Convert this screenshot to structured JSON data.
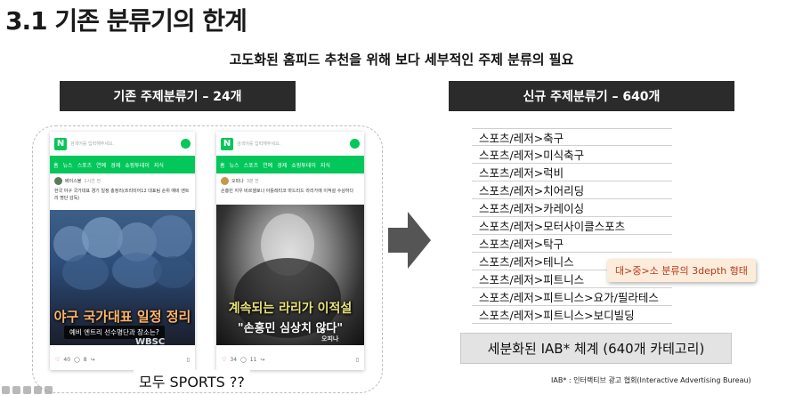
{
  "title": "3.1 기존 분류기의 한계",
  "subtitle": "고도화된 홈피드 추천을 위해 보다 세부적인 주제 분류의 필요",
  "left_header": "기존 주제분류기 – 24개",
  "right_header": "신규 주제분류기 – 640개",
  "phone1": {
    "search_placeholder": "검색어를 입력해주세요.",
    "tabs": [
      "홈",
      "뉴스",
      "스포츠",
      "연예",
      "경제",
      "쇼핑투데이",
      "지식"
    ],
    "author": "베이스볼",
    "time": "1시간 전",
    "text": "한국 야구 국가대표 경기 일정 총정리(프리미어12 대표팀 순위 예비 엔트리 명단 감독)",
    "caption_main": "야구 국가대표 일정 정리",
    "caption_sub": "예비 엔트리 선수명단과 장소는?",
    "watermark": "WBSC",
    "likes": "40",
    "comments": "8"
  },
  "phone2": {
    "search_placeholder": "검색어를 입력해주세요.",
    "tabs": [
      "홈",
      "뉴스",
      "스포츠",
      "연예",
      "경제",
      "쇼핑투데이",
      "지식"
    ],
    "author": "오피나",
    "time": "3분 전",
    "text": "손흥민 지우 비르셀로나 아틀레티코 마드리드 라리가에 이적설 수상하다",
    "caption_main": "계속되는 라리가 이적설",
    "caption_sub": "\"손흥민 심상치 않다\"",
    "watermark": "오피나",
    "likes": "34",
    "comments": "11"
  },
  "bottom_question": "모두 SPORTS ??",
  "taxonomy": [
    "스포츠/레저>축구",
    "스포츠/레저>미식축구",
    "스포츠/레저>럭비",
    "스포츠/레저>치어리딩",
    "스포츠/레저>카레이싱",
    "스포츠/레저>모터사이클스포츠",
    "스포츠/레저>탁구",
    "스포츠/레저>테니스",
    "스포츠/레저>피트니스",
    "스포츠/레저>피트니스>요가/필라테스",
    "스포츠/레저>피트니스>보디빌딩"
  ],
  "callout": "대>중>소 분류의 3depth 형태",
  "iab_label": "세분화된 IAB* 체계 (640개 카테고리)",
  "footnote": "IAB* : 인터랙티브 광고 협회(Interactive Advertising Bureau)",
  "colors": {
    "naver_green": "#03c75a",
    "header_bg": "#2b2b2b",
    "callout_bg": "#fdecd9",
    "callout_text": "#b33a1f",
    "iab_bg": "#e3e3e3",
    "arrow": "#555555"
  },
  "icons": {
    "arrow": "right-arrow-icon",
    "like": "heart-icon",
    "comment": "comment-icon",
    "share": "share-icon",
    "bookmark": "bookmark-icon"
  }
}
